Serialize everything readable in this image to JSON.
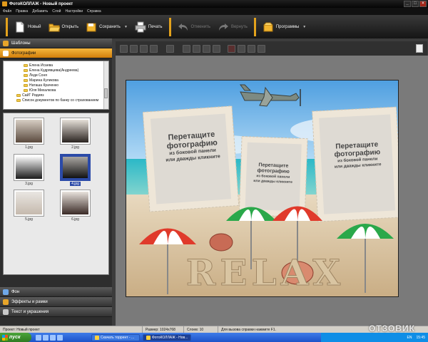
{
  "window": {
    "title": "ФотоКОЛЛАЖ - Новый проект",
    "controls": [
      "_",
      "□",
      "×"
    ]
  },
  "menu": [
    "Файл",
    "Правка",
    "Добавить",
    "Слой",
    "Настройки",
    "Справка"
  ],
  "toolbar": {
    "new": "Новый",
    "open": "Открыть",
    "save": "Сохранить",
    "print": "Печать",
    "undo": "Отменить",
    "redo": "Вернуть",
    "programs": "Программы"
  },
  "sidebar": {
    "templates": "Шаблоны",
    "photos": "Фотографии",
    "tree": [
      "Елена Исаева",
      "Елена Кудрявцева(Андреева)",
      "Леди Соня",
      "Марина Куликова",
      "Наташа Краченко",
      "Юля Михалкова",
      "СайТ Ридияз",
      "Список документов по банку со страхованием"
    ],
    "thumbnails": [
      "1.jpg",
      "2.jpg",
      "3.jpg",
      "4.jpg",
      "5.jpg",
      "6.jpg"
    ],
    "selected_thumbnail": "4.jpg",
    "background": "Фон",
    "effects": "Эффекты и рамки",
    "text": "Текст и украшения"
  },
  "collage": {
    "placeholder_big": [
      "Перетащите",
      "фотографию",
      "из боковой панели",
      "или дважды кликните"
    ],
    "placeholder_small": [
      "Перетащите",
      "фотографию",
      "из боковой панели",
      "или дважды кликните"
    ],
    "placeholder_right": [
      "Перетащите",
      "фотографию",
      "из боковой панели",
      "или дважды кликните"
    ],
    "sand_text": "RELAX"
  },
  "status": {
    "project": "Проект: Новый проект",
    "size": "Размер: 1024x768",
    "layers": "Слоев: 10",
    "hint": "Для вызова справки нажмите F1."
  },
  "taskbar": {
    "start": "пуск",
    "items": [
      "Скачать торрент - ...",
      "ФотоКОЛЛАЖ - Нов..."
    ],
    "lang": "EN",
    "clock": "15:45"
  },
  "watermark": "ОТЗОВИК",
  "colors": {
    "accent": "#e39b1b",
    "selection": "#2b4aa8"
  }
}
